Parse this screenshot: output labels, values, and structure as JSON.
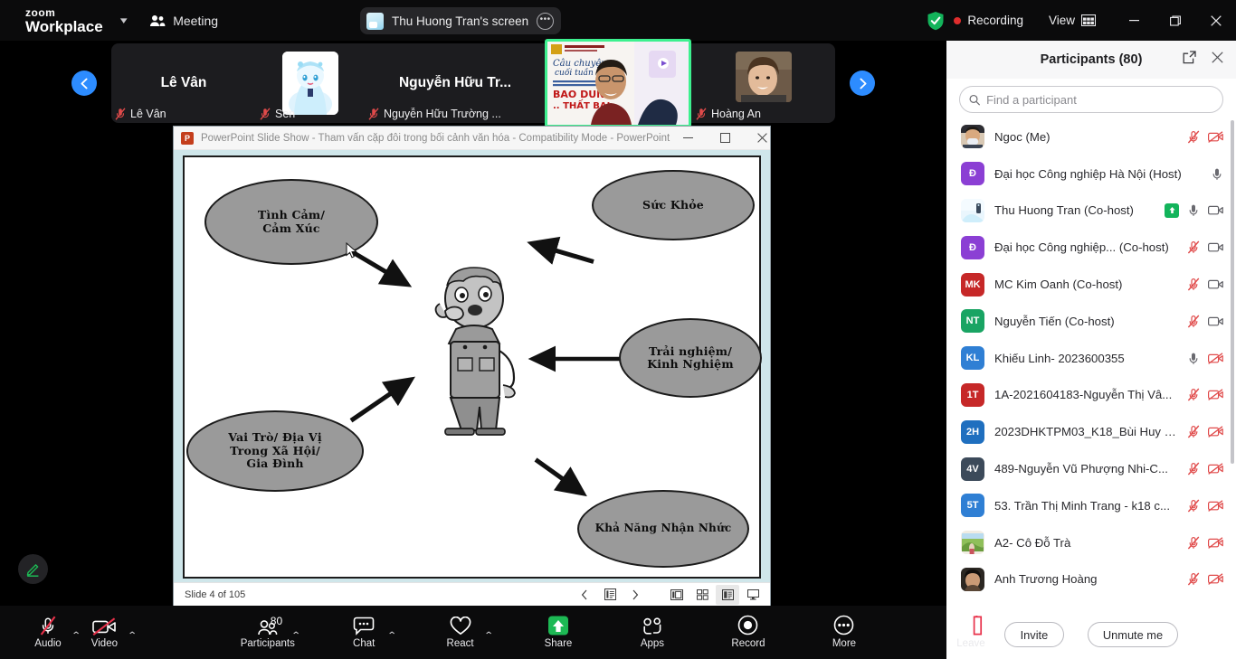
{
  "topbar": {
    "brand_line1": "zoom",
    "brand_line2": "Workplace",
    "meeting_label": "Meeting",
    "screen_share_chip": "Thu Huong Tran's screen",
    "recording_label": "Recording",
    "view_label": "View",
    "icons": {
      "chevron": "chevron-down-icon",
      "people": "people-icon",
      "more": "more-options-icon",
      "shield": "security-shield-icon",
      "minimize": "minimize-icon",
      "maximize": "maximize-icon",
      "close": "close-icon"
    },
    "accent_green": "#3df08f",
    "record_red": "#e02d2d"
  },
  "thumbstrip": {
    "tiles": [
      {
        "display_name": "Lê Vân",
        "badge_name": "Lê Vân",
        "muted": true,
        "kind": "name-only"
      },
      {
        "display_name": "",
        "badge_name": "Sen",
        "muted": true,
        "kind": "avatar"
      },
      {
        "display_name": "Nguyễn Hữu Tr...",
        "badge_name": "Nguyễn Hữu Trường ...",
        "muted": true,
        "kind": "name-only"
      },
      {
        "display_name": "",
        "badge_name": "Thu Huong Tran",
        "muted": false,
        "kind": "video-active"
      },
      {
        "display_name": "",
        "badge_name": "Hoàng An",
        "muted": true,
        "kind": "video"
      }
    ],
    "prev_label": "previous-participants",
    "next_label": "next-participants"
  },
  "powerpoint": {
    "title": "PowerPoint Slide Show  -  Tham vấn cặp đôi trong bối cảnh văn hóa  -  Compatibility Mode  -  PowerPoint",
    "icon_letter": "P",
    "status": "Slide 4 of 105",
    "slide": {
      "ovals": [
        {
          "text": "Tình Cảm/\nCảm Xúc",
          "id": "oval-tinh-cam"
        },
        {
          "text": "Sức Khỏe",
          "id": "oval-suc-khoe"
        },
        {
          "text": "Trải nghiệm/\nKinh Nghiệm",
          "id": "oval-trai-nghiem"
        },
        {
          "text": "Vai Trò/ Địa Vị\nTrong Xã Hội/\nGia Đình",
          "id": "oval-vai-tro"
        },
        {
          "text": "Khả Năng Nhận Nhức",
          "id": "oval-kha-nang"
        }
      ],
      "oval_fill": "#9a9a9a",
      "background": "#ffffff"
    }
  },
  "annotate": {
    "label": "annotate-pencil"
  },
  "participants": {
    "title": "Participants (80)",
    "search_placeholder": "Find a participant",
    "search_value": "",
    "list": [
      {
        "name": "Ngoc (Me)",
        "initials": "",
        "color": "photo-male",
        "mic": "muted",
        "cam": "off"
      },
      {
        "name": "Đại học Công nghiệp Hà Nội (Host)",
        "initials": "Đ",
        "color": "#8b3fd4",
        "mic": "on",
        "cam": "none"
      },
      {
        "name": "Thu Huong Tran (Co-host)",
        "initials": "",
        "color": "photo-banner",
        "mic": "on",
        "cam": "on",
        "sharing": true
      },
      {
        "name": "Đại học Công nghiệp... (Co-host)",
        "initials": "Đ",
        "color": "#8b3fd4",
        "mic": "muted",
        "cam": "on"
      },
      {
        "name": "MC Kim Oanh (Co-host)",
        "initials": "MK",
        "color": "#c62828",
        "mic": "muted",
        "cam": "on"
      },
      {
        "name": "Nguyễn Tiến (Co-host)",
        "initials": "NT",
        "color": "#19a463",
        "mic": "muted",
        "cam": "on"
      },
      {
        "name": "Khiếu Linh- 2023600355",
        "initials": "KL",
        "color": "#2f7fd4",
        "mic": "on",
        "cam": "off"
      },
      {
        "name": "1A-2021604183-Nguyễn Thị Vâ...",
        "initials": "1T",
        "color": "#c62828",
        "mic": "muted",
        "cam": "off"
      },
      {
        "name": "2023DHKTPM03_K18_Bùi Huy H...",
        "initials": "2H",
        "color": "#1f6fbf",
        "mic": "muted",
        "cam": "off"
      },
      {
        "name": "489-Nguyễn Vũ Phượng Nhi-C...",
        "initials": "4V",
        "color": "#3c4a5a",
        "mic": "muted",
        "cam": "off"
      },
      {
        "name": "53. Trần Thị Minh Trang - k18 c...",
        "initials": "5T",
        "color": "#2f7fd4",
        "mic": "muted",
        "cam": "off"
      },
      {
        "name": "A2- Cô Đỗ Trà",
        "initials": "",
        "color": "photo-land",
        "mic": "muted",
        "cam": "off"
      },
      {
        "name": "Anh Trương Hoàng",
        "initials": "",
        "color": "photo-girl",
        "mic": "muted",
        "cam": "off"
      }
    ],
    "invite_label": "Invite",
    "unmute_label": "Unmute me"
  },
  "toolbar": {
    "items": [
      {
        "label": "Audio",
        "icon": "mic-off-icon",
        "caret": true,
        "count": null,
        "highlight": false
      },
      {
        "label": "Video",
        "icon": "camera-off-icon",
        "caret": true,
        "count": null,
        "highlight": false
      },
      {
        "label": "Participants",
        "icon": "people-icon",
        "caret": true,
        "count": "80",
        "highlight": false
      },
      {
        "label": "Chat",
        "icon": "chat-icon",
        "caret": true,
        "count": null,
        "highlight": false
      },
      {
        "label": "React",
        "icon": "heart-icon",
        "caret": true,
        "count": null,
        "highlight": false
      },
      {
        "label": "Share",
        "icon": "share-screen-icon",
        "caret": false,
        "count": null,
        "highlight": true
      },
      {
        "label": "Apps",
        "icon": "apps-icon",
        "caret": false,
        "count": null,
        "highlight": false
      },
      {
        "label": "Record",
        "icon": "record-icon",
        "caret": false,
        "count": null,
        "highlight": false
      },
      {
        "label": "More",
        "icon": "more-dots-icon",
        "caret": false,
        "count": null,
        "highlight": false
      },
      {
        "label": "Leave",
        "icon": "leave-door-icon",
        "caret": false,
        "count": null,
        "highlight": false
      }
    ],
    "share_green": "#1db954",
    "leave_red": "#e02d2d"
  }
}
